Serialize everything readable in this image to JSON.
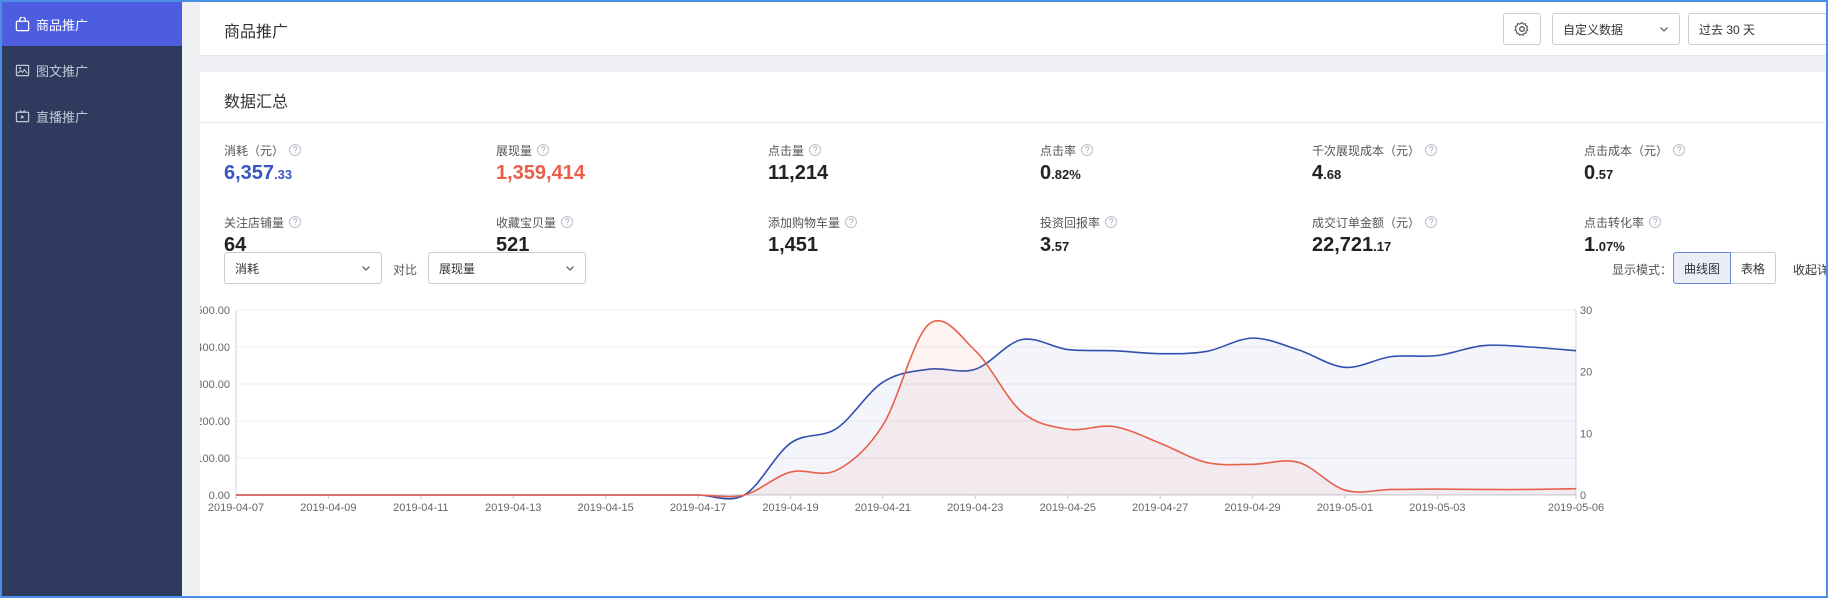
{
  "sidebar": {
    "items": [
      {
        "label": "商品推广",
        "icon": "bag-icon",
        "active": true
      },
      {
        "label": "图文推广",
        "icon": "image-icon",
        "active": false
      },
      {
        "label": "直播推广",
        "icon": "tv-icon",
        "active": false
      }
    ]
  },
  "header": {
    "title": "商品推广",
    "settings_icon": "gear-icon",
    "custom_select": "自定义数据",
    "date_range": "过去 30 天"
  },
  "summary": {
    "title": "数据汇总",
    "metrics": [
      {
        "label": "消耗（元）",
        "int": "6,357",
        "dec": ".33",
        "color": "blue"
      },
      {
        "label": "展现量",
        "int": "1,359,414",
        "dec": "",
        "color": "red"
      },
      {
        "label": "点击量",
        "int": "11,214",
        "dec": "",
        "color": ""
      },
      {
        "label": "点击率",
        "int": "0",
        "dec": ".82%",
        "color": ""
      },
      {
        "label": "千次展现成本（元）",
        "int": "4",
        "dec": ".68",
        "color": ""
      },
      {
        "label": "点击成本（元）",
        "int": "0",
        "dec": ".57",
        "color": ""
      },
      {
        "label": "关注店铺量",
        "int": "64",
        "dec": "",
        "color": ""
      },
      {
        "label": "收藏宝贝量",
        "int": "521",
        "dec": "",
        "color": ""
      },
      {
        "label": "添加购物车量",
        "int": "1,451",
        "dec": "",
        "color": ""
      },
      {
        "label": "投资回报率",
        "int": "3",
        "dec": ".57",
        "color": ""
      },
      {
        "label": "成交订单金额（元）",
        "int": "22,721",
        "dec": ".17",
        "color": ""
      },
      {
        "label": "点击转化率",
        "int": "1",
        "dec": ".07%",
        "color": ""
      }
    ],
    "help_glyph": "?"
  },
  "controls": {
    "metric_a": "消耗",
    "compare_label": "对比",
    "metric_b": "展现量",
    "mode_label": "显示模式：",
    "mode_options": [
      "曲线图",
      "表格"
    ],
    "mode_selected": "曲线图",
    "collapse_label": "收起详"
  },
  "colors": {
    "accent": "#4d5de0",
    "series_blue": "#3050b0",
    "series_red": "#e8604c",
    "sidebar_bg": "#2f3b5e"
  },
  "chart_data": {
    "type": "line",
    "x": [
      "2019-04-07",
      "2019-04-08",
      "2019-04-09",
      "2019-04-10",
      "2019-04-11",
      "2019-04-12",
      "2019-04-13",
      "2019-04-14",
      "2019-04-15",
      "2019-04-16",
      "2019-04-17",
      "2019-04-18",
      "2019-04-19",
      "2019-04-20",
      "2019-04-21",
      "2019-04-22",
      "2019-04-23",
      "2019-04-24",
      "2019-04-25",
      "2019-04-26",
      "2019-04-27",
      "2019-04-28",
      "2019-04-29",
      "2019-04-30",
      "2019-05-01",
      "2019-05-02",
      "2019-05-03",
      "2019-05-04",
      "2019-05-05",
      "2019-05-06"
    ],
    "x_tick_labels": [
      "2019-04-07",
      "2019-04-09",
      "2019-04-11",
      "2019-04-13",
      "2019-04-15",
      "2019-04-17",
      "2019-04-19",
      "2019-04-21",
      "2019-04-23",
      "2019-04-25",
      "2019-04-27",
      "2019-04-29",
      "2019-05-01",
      "2019-05-03",
      "2019-05-06"
    ],
    "y_left_ticks": [
      "500.00",
      "400.00",
      "300.00",
      "200.00",
      "100.00",
      "0.00"
    ],
    "y_left_range": [
      0,
      500
    ],
    "y_right_ticks": [
      "30",
      "20",
      "10",
      "0"
    ],
    "y_right_range": [
      0,
      30
    ],
    "series": [
      {
        "key": "blue",
        "axis": "left",
        "values": [
          0,
          0,
          0,
          0,
          0,
          0,
          0,
          0,
          0,
          0,
          0,
          0,
          140,
          180,
          305,
          340,
          340,
          420,
          393,
          390,
          382,
          388,
          424,
          392,
          345,
          374,
          377,
          404,
          400,
          390
        ]
      },
      {
        "key": "red",
        "axis": "left",
        "values": [
          0,
          0,
          0,
          0,
          0,
          0,
          0,
          0,
          0,
          0,
          0,
          0,
          62,
          67,
          189,
          462,
          390,
          225,
          178,
          185,
          140,
          88,
          83,
          88,
          13,
          15,
          16,
          15,
          15,
          17
        ]
      }
    ],
    "grid": true,
    "area_fill": true
  }
}
